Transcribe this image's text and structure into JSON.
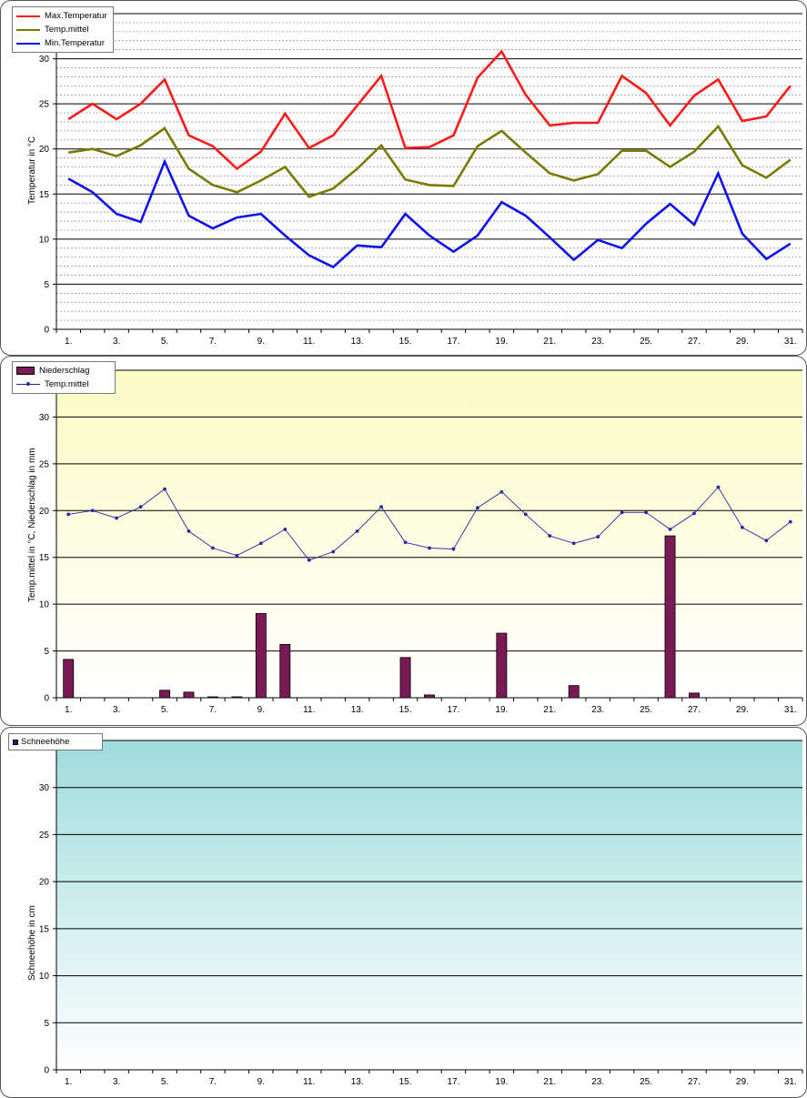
{
  "colors": {
    "max_temp": "#ff1a1a",
    "mean_temp_1": "#7a7a00",
    "min_temp": "#1010ee",
    "precip": "#7a1a55",
    "mean_temp_2": "#2a2aa0",
    "snow": "#1a1a8a",
    "bg2_top": "#fbfbc4",
    "bg2_bottom": "#ffffff",
    "bg3_top": "#9fdcdc",
    "bg3_bottom": "#ffffff"
  },
  "chart_data": [
    {
      "type": "line",
      "ylabel": "Temperatur  in °C",
      "ylim": [
        0,
        35
      ],
      "yticks": [
        0,
        5,
        10,
        15,
        20,
        25,
        30
      ],
      "x": [
        1,
        2,
        3,
        4,
        5,
        6,
        7,
        8,
        9,
        10,
        11,
        12,
        13,
        14,
        15,
        16,
        17,
        18,
        19,
        20,
        21,
        22,
        23,
        24,
        25,
        26,
        27,
        28,
        29,
        30,
        31
      ],
      "xtick_labels": [
        "1.",
        "3.",
        "5.",
        "7.",
        "9.",
        "11.",
        "13.",
        "15.",
        "17.",
        "19.",
        "21.",
        "23.",
        "25.",
        "27.",
        "29.",
        "31."
      ],
      "legend": [
        "Max.Temperatur",
        "Temp.mittel",
        "Min.Temperatur"
      ],
      "series": [
        {
          "name": "Max.Temperatur",
          "values": [
            23.3,
            25.0,
            23.3,
            25.0,
            27.7,
            21.5,
            20.3,
            17.8,
            19.7,
            23.9,
            20.1,
            21.5,
            24.8,
            28.1,
            20.1,
            20.2,
            21.5,
            27.9,
            30.8,
            26.0,
            22.6,
            22.9,
            22.9,
            28.1,
            26.2,
            22.6,
            25.9,
            27.7,
            23.1,
            23.6,
            27.0
          ]
        },
        {
          "name": "Temp.mittel",
          "values": [
            19.6,
            20.0,
            19.2,
            20.4,
            22.3,
            17.8,
            16.0,
            15.2,
            16.5,
            18.0,
            14.7,
            15.6,
            17.8,
            20.4,
            16.6,
            16.0,
            15.9,
            20.3,
            22.0,
            19.6,
            17.3,
            16.5,
            17.2,
            19.8,
            19.8,
            18.0,
            19.7,
            22.5,
            18.2,
            16.8,
            18.8
          ]
        },
        {
          "name": "Min.Temperatur",
          "values": [
            16.7,
            15.2,
            12.8,
            11.9,
            18.6,
            12.6,
            11.2,
            12.4,
            12.8,
            10.4,
            8.2,
            6.9,
            9.3,
            9.1,
            12.8,
            10.4,
            8.6,
            10.4,
            14.1,
            12.6,
            10.2,
            7.7,
            9.9,
            9.0,
            11.7,
            13.9,
            11.6,
            17.3,
            10.6,
            7.8,
            9.5
          ]
        }
      ]
    },
    {
      "type": "bar",
      "ylabel": "Temp.mittel  in °C, Niederschlag  in mm",
      "ylim": [
        0,
        35
      ],
      "yticks": [
        0,
        5,
        10,
        15,
        20,
        25,
        30
      ],
      "x": [
        1,
        2,
        3,
        4,
        5,
        6,
        7,
        8,
        9,
        10,
        11,
        12,
        13,
        14,
        15,
        16,
        17,
        18,
        19,
        20,
        21,
        22,
        23,
        24,
        25,
        26,
        27,
        28,
        29,
        30,
        31
      ],
      "xtick_labels": [
        "1.",
        "3.",
        "5.",
        "7.",
        "9.",
        "11.",
        "13.",
        "15.",
        "17.",
        "19.",
        "21.",
        "23.",
        "25.",
        "27.",
        "29.",
        "31."
      ],
      "legend": [
        "Niederschlag",
        "Temp.mittel"
      ],
      "series": [
        {
          "name": "Niederschlag",
          "type": "bar",
          "values": [
            4.1,
            0,
            0,
            0,
            0.8,
            0.6,
            0.1,
            0.1,
            9.0,
            5.7,
            0,
            0,
            0,
            0,
            4.3,
            0.3,
            0,
            0,
            6.9,
            0,
            0,
            1.3,
            0,
            0,
            0,
            17.3,
            0.5,
            0,
            0,
            0,
            0
          ]
        },
        {
          "name": "Temp.mittel",
          "type": "line",
          "values": [
            19.6,
            20.0,
            19.2,
            20.4,
            22.3,
            17.8,
            16.0,
            15.2,
            16.5,
            18.0,
            14.7,
            15.6,
            17.8,
            20.4,
            16.6,
            16.0,
            15.9,
            20.3,
            22.0,
            19.6,
            17.3,
            16.5,
            17.2,
            19.8,
            19.8,
            18.0,
            19.7,
            22.5,
            18.2,
            16.8,
            18.8
          ]
        }
      ]
    },
    {
      "type": "bar",
      "ylabel": "Schneehöhe  in cm",
      "ylim": [
        0,
        35
      ],
      "yticks": [
        0,
        5,
        10,
        15,
        20,
        25,
        30
      ],
      "x": [
        1,
        2,
        3,
        4,
        5,
        6,
        7,
        8,
        9,
        10,
        11,
        12,
        13,
        14,
        15,
        16,
        17,
        18,
        19,
        20,
        21,
        22,
        23,
        24,
        25,
        26,
        27,
        28,
        29,
        30,
        31
      ],
      "xtick_labels": [
        "1.",
        "3.",
        "5.",
        "7.",
        "9.",
        "11.",
        "13.",
        "15.",
        "17.",
        "19.",
        "21.",
        "23.",
        "25.",
        "27.",
        "29.",
        "31."
      ],
      "legend": [
        "Schneehöhe"
      ],
      "series": [
        {
          "name": "Schneehöhe",
          "values": [
            0,
            0,
            0,
            0,
            0,
            0,
            0,
            0,
            0,
            0,
            0,
            0,
            0,
            0,
            0,
            0,
            0,
            0,
            0,
            0,
            0,
            0,
            0,
            0,
            0,
            0,
            0,
            0,
            0,
            0,
            0
          ]
        }
      ]
    }
  ]
}
